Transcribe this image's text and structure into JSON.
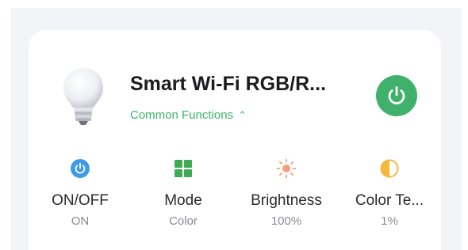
{
  "device": {
    "name": "Smart Wi-Fi RGB/R...",
    "functions_link": "Common Functions",
    "power_state": "on"
  },
  "colors": {
    "accent_green": "#3fb16a",
    "power_icon_blue": "#3d9be9",
    "mode_icon_green": "#3dab52",
    "brightness_icon_orange": "#f2a07f",
    "color_temp_icon_yellow": "#f5b93a"
  },
  "functions": [
    {
      "label": "ON/OFF",
      "value": "ON",
      "icon": "power-icon"
    },
    {
      "label": "Mode",
      "value": "Color",
      "icon": "grid-icon"
    },
    {
      "label": "Brightness",
      "value": "100%",
      "icon": "sun-icon"
    },
    {
      "label": "Color Te...",
      "value": "1%",
      "icon": "half-circle-icon"
    }
  ]
}
